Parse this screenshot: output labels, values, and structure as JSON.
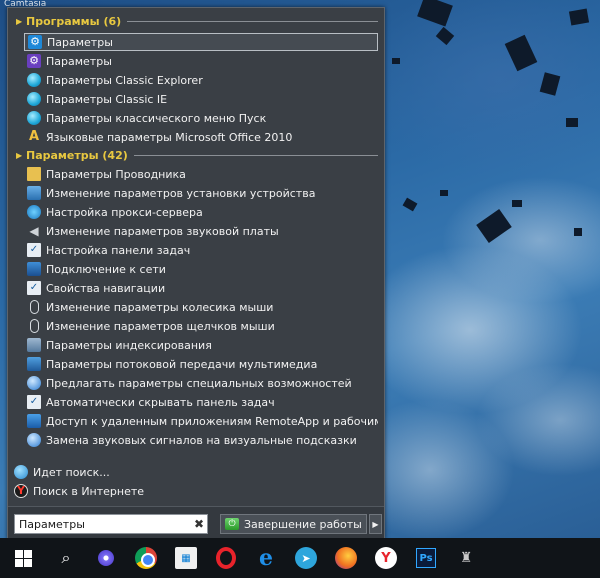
{
  "desktop": {
    "corner_text": "Camtasia"
  },
  "menu": {
    "groups": [
      {
        "title": "Программы (6)",
        "items": [
          {
            "label": "Параметры",
            "icon": "settings-gear-icon",
            "selected": true
          },
          {
            "label": "Параметры",
            "icon": "settings-gear-purple-icon"
          },
          {
            "label": "Параметры Classic Explorer",
            "icon": "classic-shell-icon"
          },
          {
            "label": "Параметры Classic IE",
            "icon": "classic-shell-icon"
          },
          {
            "label": "Параметры классического меню Пуск",
            "icon": "classic-shell-icon"
          },
          {
            "label": "Языковые параметры Microsoft Office 2010",
            "icon": "office-language-icon"
          }
        ]
      },
      {
        "title": "Параметры (42)",
        "items": [
          {
            "label": "Параметры Проводника",
            "icon": "folder-options-icon"
          },
          {
            "label": "Изменение параметров установки устройства",
            "icon": "device-install-icon"
          },
          {
            "label": "Настройка прокси-сервера",
            "icon": "proxy-globe-icon"
          },
          {
            "label": "Изменение параметров звуковой платы",
            "icon": "speaker-icon"
          },
          {
            "label": "Настройка панели задач",
            "icon": "taskbar-check-icon"
          },
          {
            "label": "Подключение к сети",
            "icon": "network-icon"
          },
          {
            "label": "Свойства навигации",
            "icon": "navigation-check-icon"
          },
          {
            "label": "Изменение параметры колесика мыши",
            "icon": "mouse-icon"
          },
          {
            "label": "Изменение параметров щелчков мыши",
            "icon": "mouse-icon"
          },
          {
            "label": "Параметры индексирования",
            "icon": "indexing-icon"
          },
          {
            "label": "Параметры потоковой передачи мультимедиа",
            "icon": "media-streaming-icon"
          },
          {
            "label": "Предлагать параметры специальных возможностей",
            "icon": "accessibility-icon"
          },
          {
            "label": "Автоматически скрывать панель задач",
            "icon": "taskbar-check-icon"
          },
          {
            "label": "Доступ к удаленным приложениям RemoteApp и рабочим столам",
            "icon": "remote-app-icon"
          },
          {
            "label": "Замена звуковых сигналов на визуальные подсказки",
            "icon": "accessibility-icon"
          }
        ]
      }
    ],
    "search_running": "Идет поиск...",
    "search_internet": "Поиск в Интернете",
    "search_value": "Параметры",
    "shutdown_label": "Завершение работы"
  },
  "taskbar": {
    "ps_label": "Ps",
    "telegram_glyph": "➤",
    "yandex_glyph": "Y",
    "edge_glyph": "e"
  },
  "colors": {
    "menu_bg": "#3a3f45",
    "group_title": "#e8c840",
    "taskbar_bg": "#101418"
  }
}
